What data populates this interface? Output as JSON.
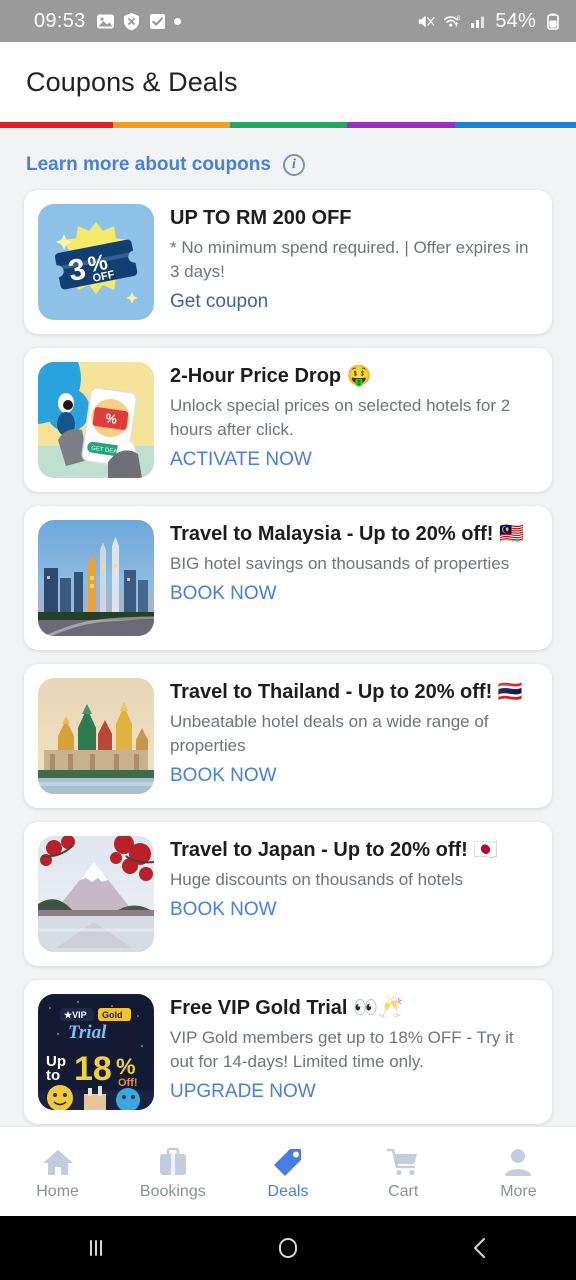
{
  "status_bar": {
    "time": "09:53",
    "battery_percent": "54%",
    "icons_left": [
      "image-icon",
      "shield-x-icon",
      "checkbox-icon",
      "dot-icon"
    ],
    "icons_right": [
      "mute-icon",
      "wifi-6-icon",
      "signal-bars-icon",
      "battery-icon"
    ]
  },
  "header": {
    "title": "Coupons & Deals",
    "accent_bar_colors": [
      "#e02020",
      "#f0a020",
      "#26a65b",
      "#9b2fc4",
      "#1b84d6"
    ]
  },
  "learn_more": {
    "label": "Learn more about coupons",
    "info_icon": "info-icon",
    "link_color": "#4a7de0"
  },
  "deals": [
    {
      "id": "coupon-rm200",
      "thumb": "coupon-3-percent-off-badge",
      "title": "UP TO RM 200 OFF",
      "title_emoji": "",
      "description": "* No minimum spend required. | Offer expires in 3 days!",
      "cta": "Get coupon"
    },
    {
      "id": "two-hour-price-drop",
      "thumb": "phone-price-drop-illustration",
      "title": "2-Hour Price Drop",
      "title_emoji": "🤑",
      "description": "Unlock special prices on selected hotels for 2 hours after click.",
      "cta": "ACTIVATE NOW"
    },
    {
      "id": "travel-malaysia",
      "thumb": "kuala-lumpur-skyline-photo",
      "title": "Travel to Malaysia - Up to 20% off!",
      "title_emoji": "🇲🇾",
      "description": "BIG hotel savings on thousands of properties",
      "cta": "BOOK NOW"
    },
    {
      "id": "travel-thailand",
      "thumb": "thailand-grand-palace-photo",
      "title": "Travel to Thailand - Up to 20% off!",
      "title_emoji": "🇹🇭",
      "description": "Unbeatable hotel deals on a wide range of properties",
      "cta": "BOOK NOW"
    },
    {
      "id": "travel-japan",
      "thumb": "mount-fuji-photo",
      "title": "Travel to Japan - Up to 20% off!",
      "title_emoji": "🇯🇵",
      "description": "Huge discounts on thousands of hotels",
      "cta": "BOOK NOW"
    },
    {
      "id": "vip-gold-trial",
      "thumb": "vip-gold-trial-18-percent-banner",
      "title": "Free VIP Gold Trial",
      "title_emoji": "👀🥂",
      "description": "VIP Gold members get up to 18% OFF - Try it out for 14-days! Limited time only.",
      "cta": "UPGRADE NOW"
    }
  ],
  "bottom_nav": {
    "active": "Deals",
    "active_color": "#4a7de0",
    "items": [
      {
        "label": "Home",
        "icon": "home-icon"
      },
      {
        "label": "Bookings",
        "icon": "suitcase-icon"
      },
      {
        "label": "Deals",
        "icon": "tag-icon"
      },
      {
        "label": "Cart",
        "icon": "cart-icon"
      },
      {
        "label": "More",
        "icon": "person-icon"
      }
    ]
  },
  "system_nav": {
    "items": [
      {
        "name": "recents-button",
        "glyph": "|||"
      },
      {
        "name": "home-button",
        "glyph": "◯"
      },
      {
        "name": "back-button",
        "glyph": "‹"
      }
    ]
  }
}
